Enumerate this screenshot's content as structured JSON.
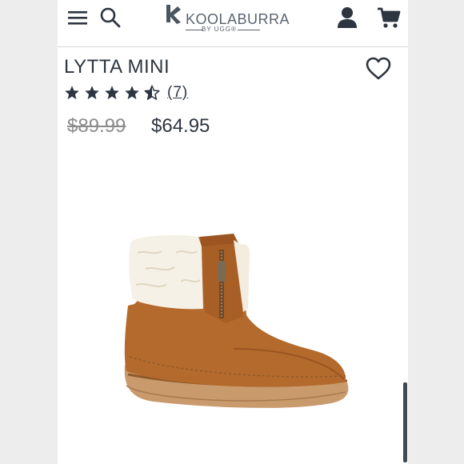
{
  "header": {
    "logo_main": "KOOLABURRA",
    "logo_sub": "BY UGG®",
    "icons": [
      "menu-icon",
      "search-icon",
      "account-icon",
      "cart-icon"
    ]
  },
  "product": {
    "title": "LYTTA MINI",
    "rating": 4.5,
    "rating_max": 5,
    "reviews_label": "(7)",
    "price_original": "$89.99",
    "price_sale": "$64.95"
  },
  "colors": {
    "text": "#2d3540",
    "muted": "#8c8c8c",
    "boot": "#b46a2c",
    "shearling": "#f6f1e6",
    "sole": "#c99a6c"
  }
}
